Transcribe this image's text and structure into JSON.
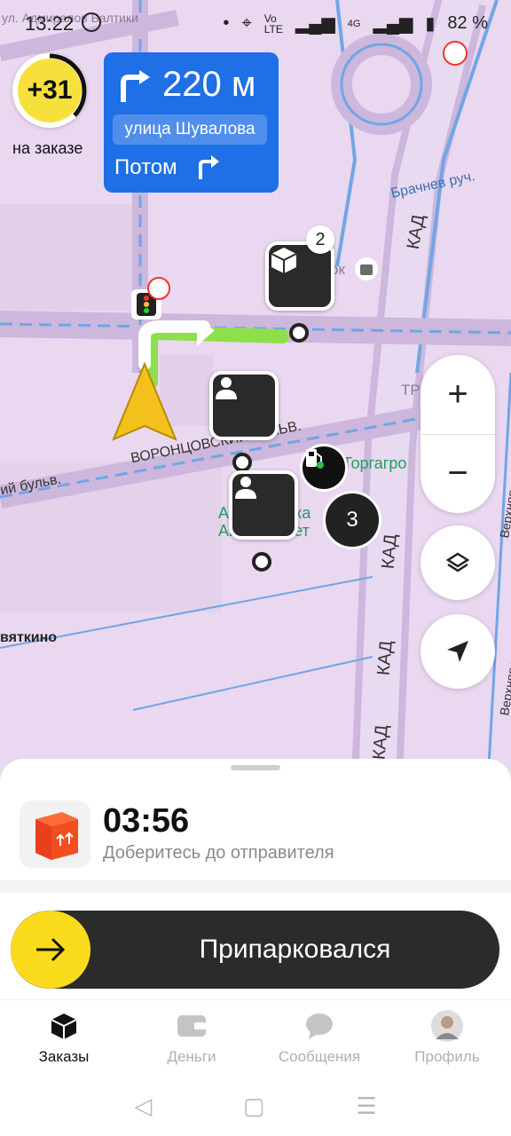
{
  "status": {
    "time": "13:22",
    "battery": "82 %",
    "network": "4G"
  },
  "bonus": {
    "value": "+31",
    "label": "на заказе"
  },
  "nav": {
    "distance": "220 м",
    "street": "улица Шувалова",
    "then": "Потом"
  },
  "map": {
    "labels": {
      "top_street": "ул. Адмиралов Балтики",
      "brook": "Брачнев руч.",
      "kad_1": "КАД",
      "kad_2": "КАД",
      "kad_3": "КАД",
      "kad_4": "КАД",
      "vorontsov": "ВОРОНЦОВСКИЙ БУЛЬВ.",
      "bulv_left": "ий бульв.",
      "torgagro": "Торгагро",
      "parking": "Автостоянка Авто Паркет",
      "vyatkino": "вяткино",
      "verkhnyaya_1": "Верхняя ул.",
      "verkhnyaya_2": "Верхняя ул.",
      "tr": "ТР",
      "shop": "ок"
    },
    "cluster_count": "3",
    "pin_badge": "2"
  },
  "controls": {
    "zoom_in": "+",
    "zoom_out": "−"
  },
  "order": {
    "timer": "03:56",
    "subtitle": "Доберитесь до отправителя"
  },
  "action": {
    "label": "Припарковался"
  },
  "tabs": [
    {
      "label": "Заказы",
      "icon": "box-icon"
    },
    {
      "label": "Деньги",
      "icon": "wallet-icon"
    },
    {
      "label": "Сообщения",
      "icon": "chat-icon"
    },
    {
      "label": "Профиль",
      "icon": "avatar-icon"
    }
  ],
  "colors": {
    "nav_blue": "#1f6fe6",
    "accent_yellow": "#fbdc1c",
    "route_green": "#8ee04a",
    "map_bg": "#ead7f0"
  }
}
